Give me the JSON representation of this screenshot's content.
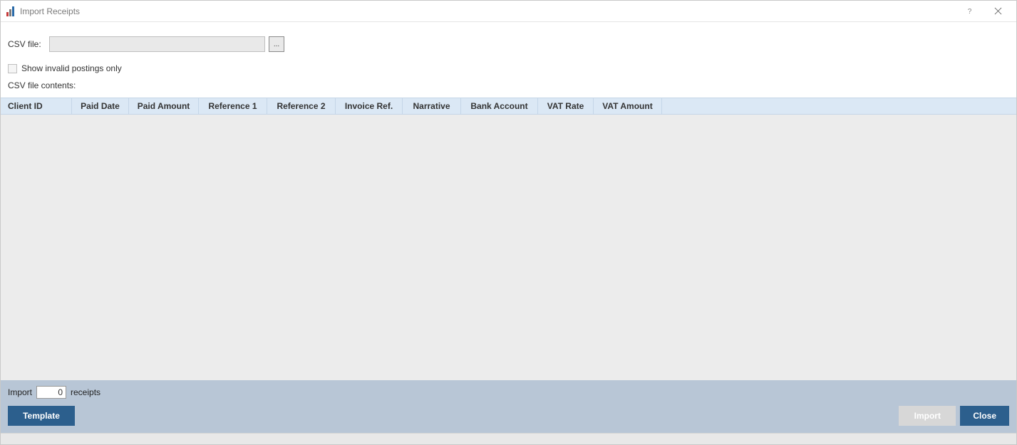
{
  "window": {
    "title": "Import Receipts"
  },
  "form": {
    "csv_file_label": "CSV file:",
    "csv_file_value": "",
    "browse_label": "...",
    "show_invalid_label": "Show invalid postings only",
    "contents_label": "CSV file contents:"
  },
  "columns": [
    "Client ID",
    "Paid Date",
    "Paid Amount",
    "Reference 1",
    "Reference 2",
    "Invoice Ref.",
    "Narrative",
    "Bank Account",
    "VAT Rate",
    "VAT Amount"
  ],
  "footer": {
    "import_prefix": "Import",
    "import_suffix": "receipts",
    "import_count": "0",
    "template_label": "Template",
    "import_label": "Import",
    "close_label": "Close"
  }
}
